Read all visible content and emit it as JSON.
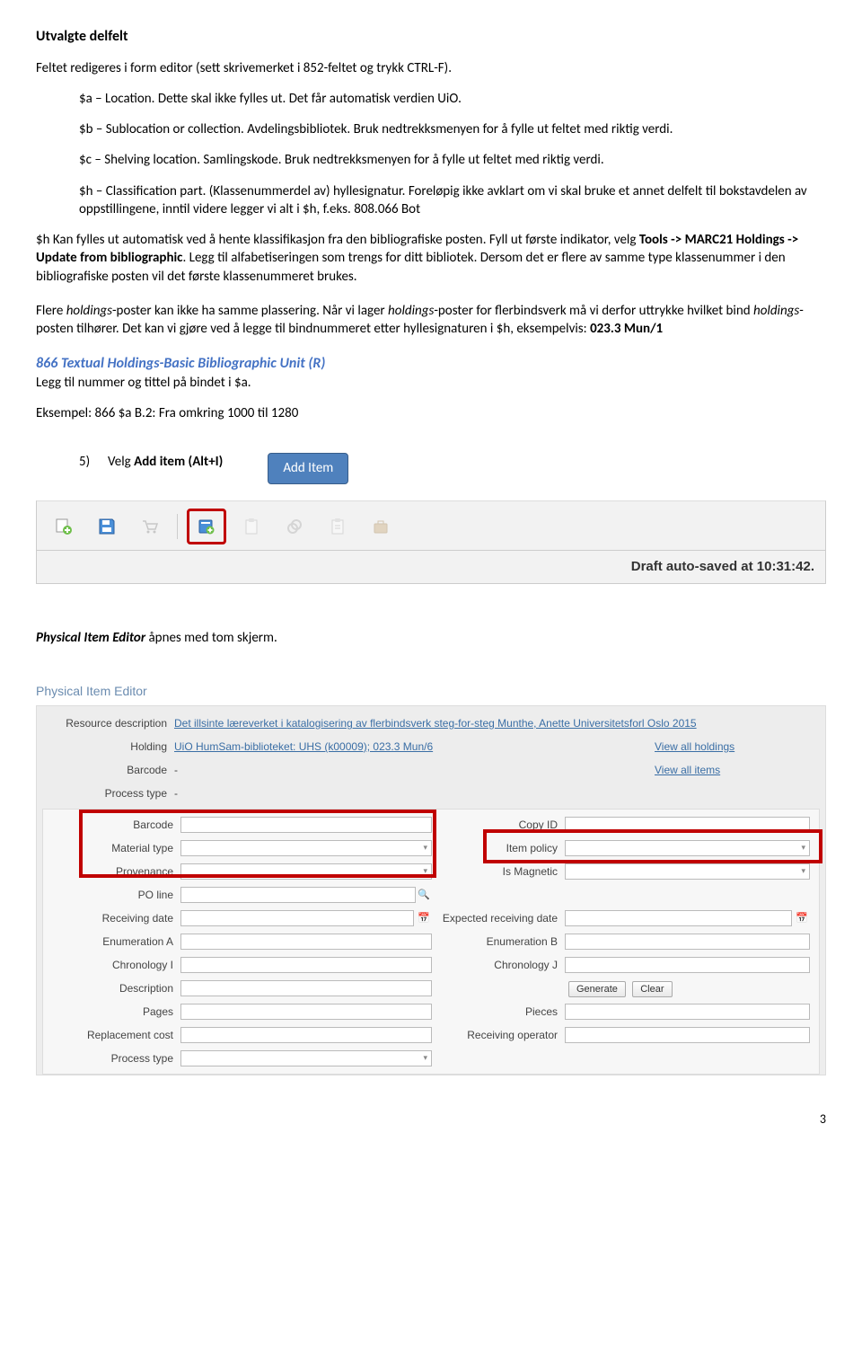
{
  "title": "Utvalgte delfelt",
  "intro": "Feltet redigeres i form editor (sett skrivemerket i 852-feltet og trykk CTRL-F).",
  "fields": {
    "a": "$a – Location. Dette skal ikke fylles ut. Det får automatisk verdien UiO.",
    "b": "$b – Sublocation or collection. Avdelingsbibliotek. Bruk nedtrekksmenyen for å fylle ut feltet med riktig verdi.",
    "c": "$c – Shelving location. Samlingskode. Bruk nedtrekksmenyen for å fylle ut feltet med riktig verdi.",
    "h": "$h – Classification part. (Klassenummerdel av) hyllesignatur. Foreløpig ikke avklart om vi skal bruke et annet delfelt til bokstavdelen av oppstillingene, inntil videre legger vi alt i $h, f.eks. 808.066 Bot"
  },
  "para1_pre": "$h Kan fylles ut automatisk ved å hente klassifikasjon fra den bibliografiske posten. Fyll ut første indikator, velg ",
  "para1_bold": "Tools -> MARC21 Holdings -> Update from bibliographic",
  "para1_post": ". Legg til alfabetiseringen som trengs for ditt bibliotek. Dersom det er flere av samme type klassenummer i den bibliografiske posten vil det første klassenummeret brukes.",
  "para2_a": "Flere ",
  "para2_b": "holdings",
  "para2_c": "-poster kan ikke ha samme plassering. Når vi lager ",
  "para2_d": "holdings",
  "para2_e": "-poster for flerbindsverk må vi derfor uttrykke hvilket bind ",
  "para2_f": "holdings",
  "para2_g": "-posten tilhører. Det kan vi gjøre ved å legge til bindnummeret etter hyllesignaturen i $h, eksempelvis: ",
  "para2_bold": "023.3 Mun/1",
  "section866": "866 Textual Holdings-Basic Bibliographic Unit (R)",
  "section866_sub": "Legg til nummer og tittel på bindet i $a.",
  "example": "Eksempel: 866 $a B.2: Fra omkring 1000 til 1280",
  "step5_num": "5)",
  "step5_a": "Velg ",
  "step5_b": "Add item (Alt+I)",
  "callout": "Add Item",
  "draft_saved": "Draft auto-saved at 10:31:42.",
  "phys_editor_a": "Physical Item Editor",
  "phys_editor_b": " åpnes med tom skjerm.",
  "editor": {
    "title": "Physical Item Editor",
    "resource_label": "Resource description",
    "resource_value": "Det illsinte læreverket i katalogisering av flerbindsverk steg-for-steg Munthe, Anette Universitetsforl Oslo 2015",
    "holding_label": "Holding",
    "holding_value": "UiO HumSam-biblioteket: UHS (k00009); 023.3 Mun/6",
    "barcode_label": "Barcode",
    "barcode_value": "-",
    "process_label": "Process type",
    "process_value": "-",
    "view_holdings": "View all holdings",
    "view_items": "View all items",
    "inner": {
      "barcode": "Barcode",
      "copyid": "Copy ID",
      "material": "Material type",
      "itempolicy": "Item policy",
      "provenance": "Provenance",
      "ismagnetic": "Is Magnetic",
      "po": "PO line",
      "recdate": "Receiving date",
      "exprecdate": "Expected receiving date",
      "enumA": "Enumeration A",
      "enumB": "Enumeration B",
      "chronI": "Chronology I",
      "chronJ": "Chronology J",
      "desc": "Description",
      "generate": "Generate",
      "clear": "Clear",
      "pages": "Pages",
      "pieces": "Pieces",
      "replcost": "Replacement cost",
      "recop": "Receiving operator",
      "proctype2": "Process type"
    }
  },
  "page_number": "3"
}
